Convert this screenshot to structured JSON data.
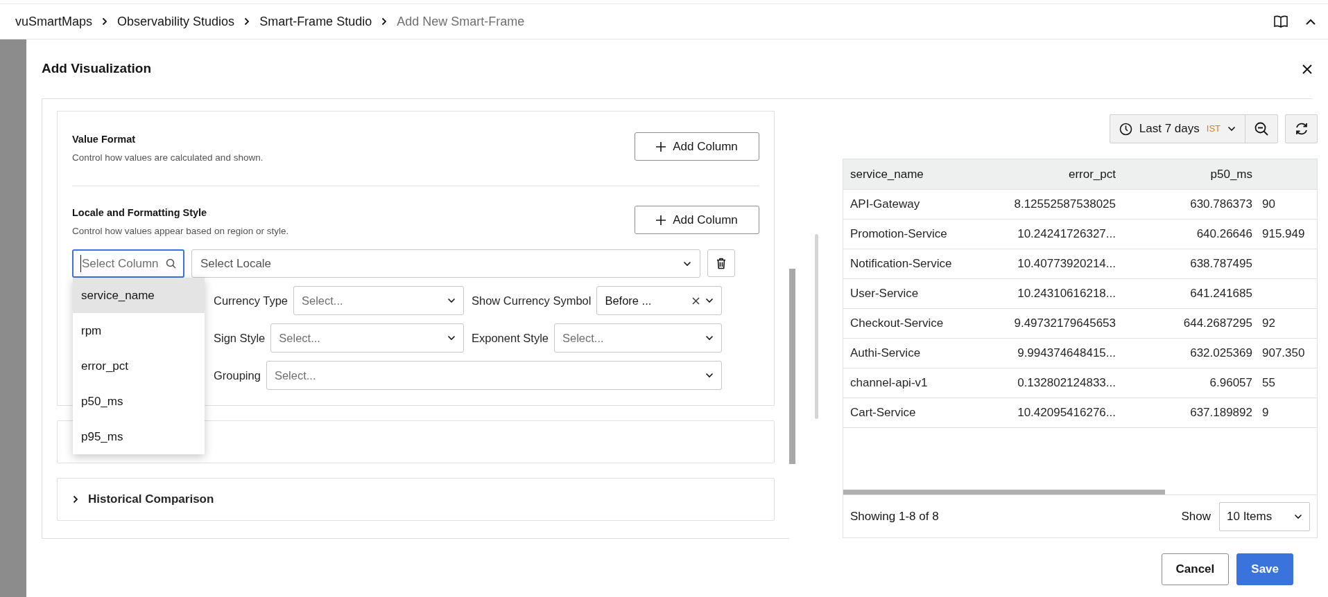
{
  "breadcrumb": [
    {
      "label": "vuSmartMaps",
      "current": false
    },
    {
      "label": "Observability Studios",
      "current": false
    },
    {
      "label": "Smart-Frame Studio",
      "current": false
    },
    {
      "label": "Add New Smart-Frame",
      "current": true
    }
  ],
  "dialog": {
    "title": "Add Visualization",
    "settings": {
      "sections": [
        {
          "title": "Value Format",
          "description": "Control how values are calculated and shown.",
          "button": "Add Column"
        },
        {
          "title": "Locale and Formatting Style",
          "description": "Control how values appear based on region or style.",
          "button": "Add Column"
        }
      ],
      "column_select": {
        "placeholder": "Select Column",
        "focused": true
      },
      "locale_select": {
        "placeholder": "Select Locale"
      },
      "field_rows": [
        [
          {
            "label": "Currency Type",
            "placeholder": "Select..."
          },
          {
            "label": "Show Currency Symbol",
            "value": "Before ...",
            "clearable": true
          }
        ],
        [
          {
            "label": "Sign Style",
            "placeholder": "Select..."
          },
          {
            "label": "Exponent Style",
            "placeholder": "Select..."
          }
        ],
        [
          {
            "label": "Grouping",
            "placeholder": "Select..."
          }
        ]
      ],
      "column_options": [
        {
          "label": "service_name",
          "selected": true
        },
        {
          "label": "rpm",
          "selected": false
        },
        {
          "label": "error_pct",
          "selected": false
        },
        {
          "label": "p50_ms",
          "selected": false
        },
        {
          "label": "p95_ms",
          "selected": false
        }
      ]
    },
    "collapsed_sections": [
      {
        "title": "Historical Comparison",
        "expanded": false
      }
    ],
    "preview": {
      "time_range": {
        "label": "Last 7 days",
        "timezone": "IST"
      },
      "table": {
        "columns": [
          "service_name",
          "error_pct",
          "p50_ms"
        ],
        "rows": [
          [
            "API-Gateway",
            "8.12552587538025",
            "630.786373",
            "90"
          ],
          [
            "Promotion-Service",
            "10.24241726327...",
            "640.26646",
            "915.949"
          ],
          [
            "Notification-Service",
            "10.40773920214...",
            "638.787495"
          ],
          [
            "User-Service",
            "10.24310616218...",
            "641.241685"
          ],
          [
            "Checkout-Service",
            "9.49732179645653",
            "644.2687295",
            "92"
          ],
          [
            "Authi-Service",
            "9.994374648415...",
            "632.025369",
            "907.350"
          ],
          [
            "channel-api-v1",
            "0.132802124833...",
            "6.96057",
            "55"
          ],
          [
            "Cart-Service",
            "10.42095416276...",
            "637.189892",
            "9"
          ]
        ]
      },
      "summary": "Showing 1-8 of 8",
      "page_size_label": "Show",
      "page_size": "10 Items"
    },
    "buttons": [
      {
        "label": "Cancel",
        "kind": "secondary"
      },
      {
        "label": "Save",
        "kind": "primary"
      }
    ]
  }
}
